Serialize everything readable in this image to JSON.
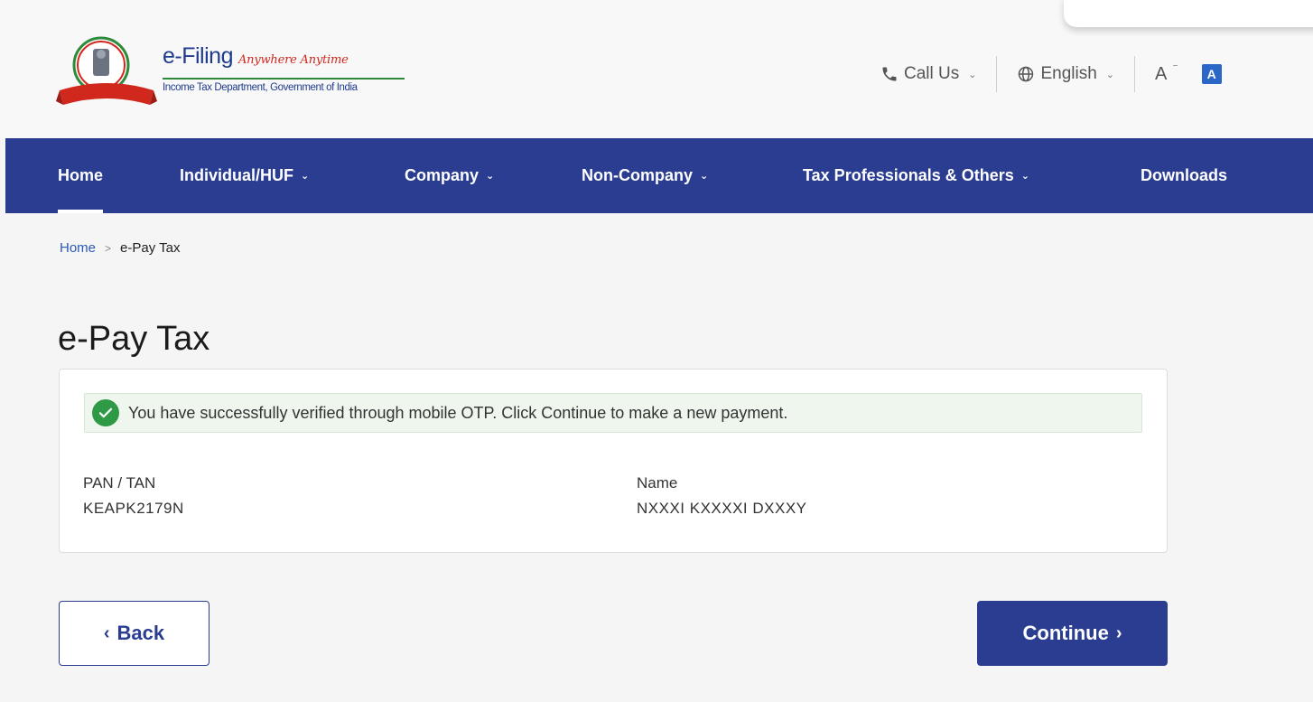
{
  "header": {
    "brand_title": "e-Filing",
    "brand_tagline": "Anywhere Anytime",
    "brand_sub": "Income Tax Department, Government of India",
    "call_us_label": "Call Us",
    "language_label": "English",
    "font_size_label": "A",
    "accessibility_badge": "A"
  },
  "nav": {
    "items": [
      {
        "label": "Home",
        "active": true
      },
      {
        "label": "Individual/HUF"
      },
      {
        "label": "Company"
      },
      {
        "label": "Non-Company"
      },
      {
        "label": "Tax Professionals & Others"
      },
      {
        "label": "Downloads"
      }
    ]
  },
  "breadcrumb": {
    "home": "Home",
    "separator": ">",
    "current": "e-Pay Tax"
  },
  "page": {
    "title": "e-Pay Tax"
  },
  "card": {
    "success_message": "You have successfully verified through mobile OTP. Click Continue to make a new payment.",
    "pan_label": "PAN / TAN",
    "pan_value": "KEAPK2179N",
    "name_label": "Name",
    "name_value": "NXXXI KXXXXI DXXXY"
  },
  "buttons": {
    "back_label": "Back",
    "continue_label": "Continue"
  },
  "colors": {
    "primary": "#2a3d91",
    "success": "#2e9a46",
    "link": "#2a59b8"
  }
}
